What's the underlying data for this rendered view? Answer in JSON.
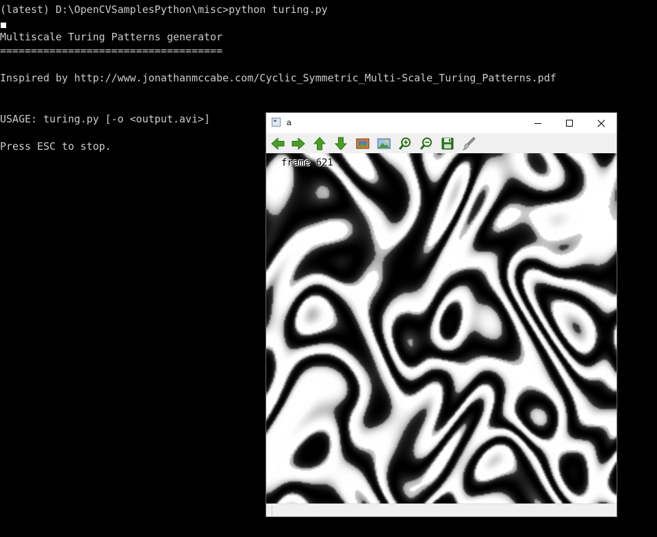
{
  "console": {
    "lines": [
      "(latest) D:\\OpenCVSamplesPython\\misc>python turing.py",
      "",
      "Multiscale Turing Patterns generator",
      "====================================",
      "",
      "Inspired by http://www.jonathanmccabe.com/Cyclic_Symmetric_Multi-Scale_Turing_Patterns.pdf",
      "",
      "",
      "USAGE: turing.py [-o <output.avi>]",
      "",
      "Press ESC to stop."
    ]
  },
  "window": {
    "title": "a",
    "frame_label": "frame 621",
    "toolbar": [
      {
        "name": "pan-left-button",
        "icon": "arrow-left-icon",
        "color": "#3f9a20"
      },
      {
        "name": "pan-right-button",
        "icon": "arrow-right-icon",
        "color": "#3f9a20"
      },
      {
        "name": "pan-up-button",
        "icon": "arrow-up-icon",
        "color": "#3f9a20"
      },
      {
        "name": "pan-down-button",
        "icon": "arrow-down-icon",
        "color": "#3f9a20"
      },
      {
        "name": "zoom-fit-button",
        "icon": "image-zoom-fit-icon",
        "color": "#c8642a"
      },
      {
        "name": "zoom-original-button",
        "icon": "image-zoom-original-icon",
        "color": "#2f7fc0"
      },
      {
        "name": "zoom-in-button",
        "icon": "magnifier-plus-icon",
        "color": "#3a7a24"
      },
      {
        "name": "zoom-out-button",
        "icon": "magnifier-minus-icon",
        "color": "#3a7a24"
      },
      {
        "name": "save-button",
        "icon": "floppy-disk-icon",
        "color": "#2f7a28"
      },
      {
        "name": "properties-button",
        "icon": "brush-icon",
        "color": "#8a8a8a"
      }
    ]
  }
}
